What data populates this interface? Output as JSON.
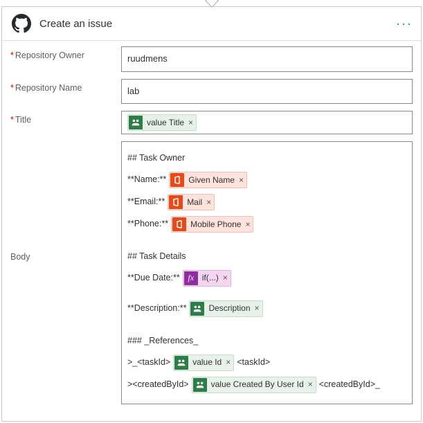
{
  "header": {
    "title": "Create an issue"
  },
  "labels": {
    "repoOwner": "Repository Owner",
    "repoName": "Repository Name",
    "title": "Title",
    "body": "Body"
  },
  "values": {
    "repoOwner": "ruudmens",
    "repoName": "lab"
  },
  "tokens": {
    "valueTitle": "value Title",
    "givenName": "Given Name",
    "mail": "Mail",
    "mobilePhone": "Mobile Phone",
    "ifExpr": "if(...)",
    "description": "Description",
    "valueId": "value Id",
    "valueCreatedByUserId": "value Created By User Id"
  },
  "bodyText": {
    "taskOwnerHeading": "## Task Owner",
    "nameLabel": "**Name:**",
    "emailLabel": "**Email:**",
    "phoneLabel": "**Phone:**",
    "taskDetailsHeading": "## Task Details",
    "dueDateLabel": "**Due Date:**",
    "descriptionLabel": "**Description:**",
    "referencesHeading": "### _References_",
    "taskIdOpen": ">_<taskId>",
    "taskIdClose": "<taskId>",
    "createdByOpen": "><createdById>",
    "createdByClose": "<createdById>_"
  }
}
